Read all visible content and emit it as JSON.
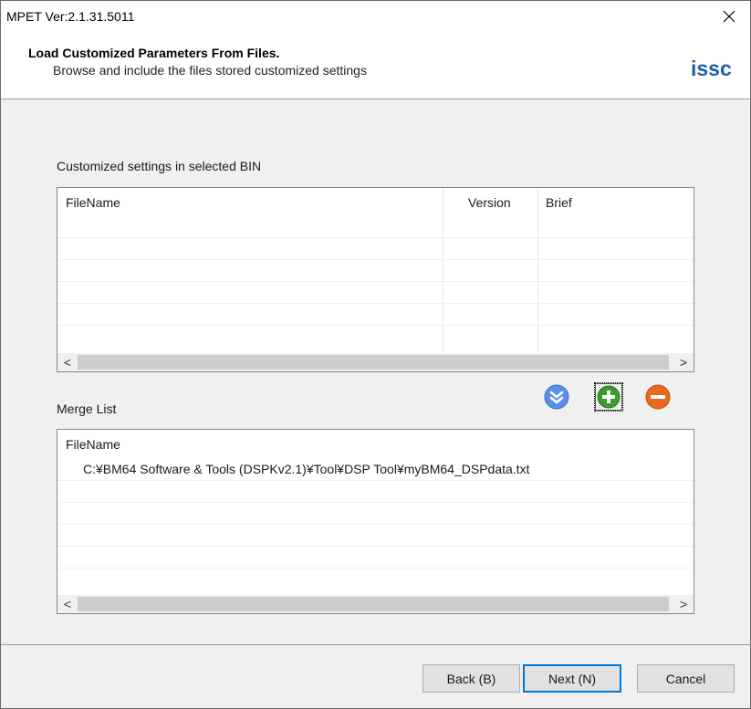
{
  "window": {
    "title": "MPET Ver:2.1.31.5011"
  },
  "header": {
    "title": "Load Customized Parameters From Files.",
    "subtitle": "Browse and include the files stored customized settings",
    "logo": "issc"
  },
  "customized": {
    "label": "Customized settings in selected BIN",
    "columns": [
      "FileName",
      "Version",
      "Brief"
    ]
  },
  "merge": {
    "label": "Merge List",
    "column": "FileName",
    "files": [
      "C:¥BM64 Software & Tools (DSPKv2.1)¥Tool¥DSP Tool¥myBM64_DSPdata.txt"
    ]
  },
  "scroll": {
    "left": "<",
    "right": ">"
  },
  "buttons": {
    "back": "Back (B)",
    "next": "Next (N)",
    "cancel": "Cancel"
  },
  "colors": {
    "logo": "#1e5ea8",
    "down_icon": "#5b8ee6",
    "add_icon": "#3a9a2c",
    "remove_icon": "#e86a1c",
    "default_border": "#0078d7"
  },
  "icons": {
    "down": "down-arrow-icon",
    "add": "add-icon",
    "remove": "remove-icon",
    "close": "close-icon"
  }
}
